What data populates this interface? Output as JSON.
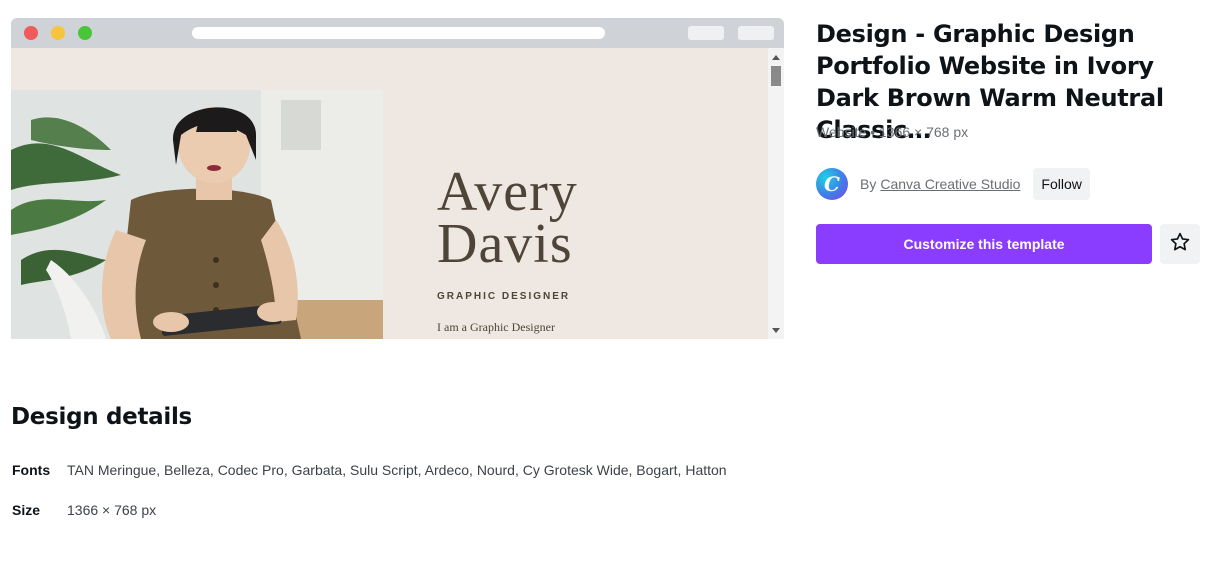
{
  "preview": {
    "hero_name": "Avery\nDavis",
    "hero_role": "GRAPHIC DESIGNER",
    "hero_intro": "I am a Graphic Designer"
  },
  "template": {
    "title": "Design - Graphic Design Portfolio Website in Ivory Dark Brown Warm Neutral Classic…",
    "meta": "Website • 1366 × 768 px"
  },
  "creator": {
    "avatar_letter": "C",
    "by_label": "By",
    "name": "Canva Creative Studio",
    "follow_label": "Follow"
  },
  "actions": {
    "customize_label": "Customize this template",
    "favorite_icon": "star-outline-icon"
  },
  "details": {
    "heading": "Design details",
    "fonts_label": "Fonts",
    "fonts_value": "TAN Meringue, Belleza, Codec Pro, Garbata, Sulu Script, Ardeco, Nourd, Cy Grotesk Wide, Bogart, Hatton",
    "size_label": "Size",
    "size_value": "1366 × 768 px"
  },
  "colors": {
    "accent": "#8b3dff",
    "preview_background": "#efe8e2",
    "preview_text": "#4f4438"
  }
}
